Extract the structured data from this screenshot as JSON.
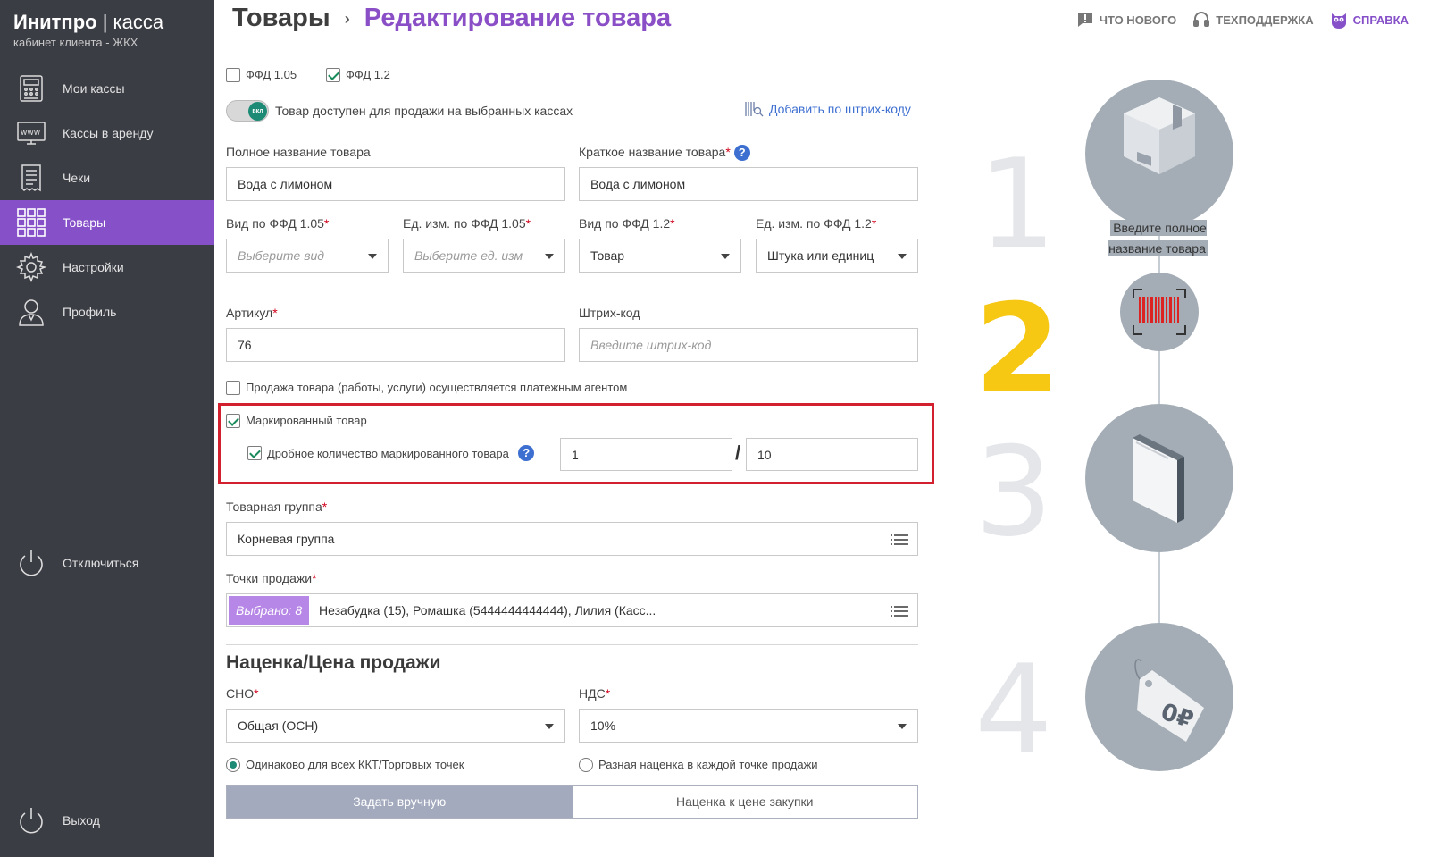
{
  "brand": {
    "name": "Инитпро",
    "divider": "|",
    "product": "касса",
    "subtitle": "кабинет клиента - ЖКХ"
  },
  "sidebar": {
    "items": [
      {
        "label": "Мои кассы",
        "icon": "cash-register-icon"
      },
      {
        "label": "Кассы в аренду",
        "icon": "www-register-icon"
      },
      {
        "label": "Чеки",
        "icon": "receipt-icon"
      },
      {
        "label": "Товары",
        "icon": "grid-icon",
        "active": true
      },
      {
        "label": "Настройки",
        "icon": "gear-icon"
      },
      {
        "label": "Профиль",
        "icon": "user-icon"
      }
    ],
    "disconnect": "Отключиться",
    "logout": "Выход"
  },
  "header": {
    "breadcrumb_root": "Товары",
    "breadcrumb_sep": "›",
    "title": "Редактирование товара",
    "links": {
      "whats_new": "ЧТО НОВОГО",
      "support": "ТЕХПОДДЕРЖКА",
      "help": "СПРАВКА"
    }
  },
  "form": {
    "ffd105": {
      "label": "ФФД 1.05",
      "checked": false
    },
    "ffd12": {
      "label": "ФФД 1.2",
      "checked": true
    },
    "toggle": {
      "knob": "вкл",
      "label": "Товар доступен для продажи на выбранных кассах",
      "on": true
    },
    "barcode_link": "Добавить по штрих-коду",
    "full_name": {
      "label": "Полное название товара",
      "value": "Вода с лимоном"
    },
    "short_name": {
      "label": "Краткое название товара",
      "value": "Вода с лимоном",
      "help": "?"
    },
    "kind105": {
      "label": "Вид по ФФД 1.05",
      "placeholder": "Выберите вид"
    },
    "unit105": {
      "label": "Ед. изм. по ФФД 1.05",
      "placeholder": "Выберите ед. изм"
    },
    "kind12": {
      "label": "Вид по ФФД 1.2",
      "value": "Товар"
    },
    "unit12": {
      "label": "Ед. изм. по ФФД 1.2",
      "value": "Штука или единиц"
    },
    "article": {
      "label": "Артикул",
      "value": "76"
    },
    "barcode": {
      "label": "Штрих-код",
      "placeholder": "Введите штрих-код"
    },
    "agent": {
      "label": "Продажа товара (работы, услуги) осуществляется платежным агентом",
      "checked": false
    },
    "marked": {
      "label": "Маркированный товар",
      "checked": true
    },
    "fractional": {
      "label": "Дробное количество маркированного товара",
      "checked": true,
      "help": "?",
      "numerator": "1",
      "slash": "/",
      "denominator": "10"
    },
    "group": {
      "label": "Товарная группа",
      "value": "Корневая группа"
    },
    "points": {
      "label": "Точки продажи",
      "badge": "Выбрано: 8",
      "value": "Незабудка (15), Ромашка (5444444444444), Лилия (Касс..."
    },
    "markup_title": "Наценка/Цена продажи",
    "sno": {
      "label": "СНО",
      "value": "Общая (ОСН)"
    },
    "vat": {
      "label": "НДС",
      "value": "10%"
    },
    "same_markup": {
      "label": "Одинаково для всех ККТ/Торговых точек",
      "checked": true
    },
    "diff_markup": {
      "label": "Разная наценка в каждой точке продажи",
      "checked": false
    },
    "manual_btn": "Задать вручную",
    "purchase_btn": "Наценка к цене закупки"
  },
  "steps": {
    "items": [
      {
        "number": "1",
        "icon": "box-icon"
      },
      {
        "number": "2",
        "icon": "barcode-icon",
        "current": true
      },
      {
        "number": "3",
        "icon": "folder-icon"
      },
      {
        "number": "4",
        "icon": "price-tag-icon"
      }
    ],
    "hint": "Введите полное название товара",
    "price_tag": "0₽"
  },
  "colors": {
    "accent": "#8650c9",
    "sidebar": "#3b3d45",
    "highlight_step": "#f6c813",
    "box_border": "#d3202f"
  }
}
